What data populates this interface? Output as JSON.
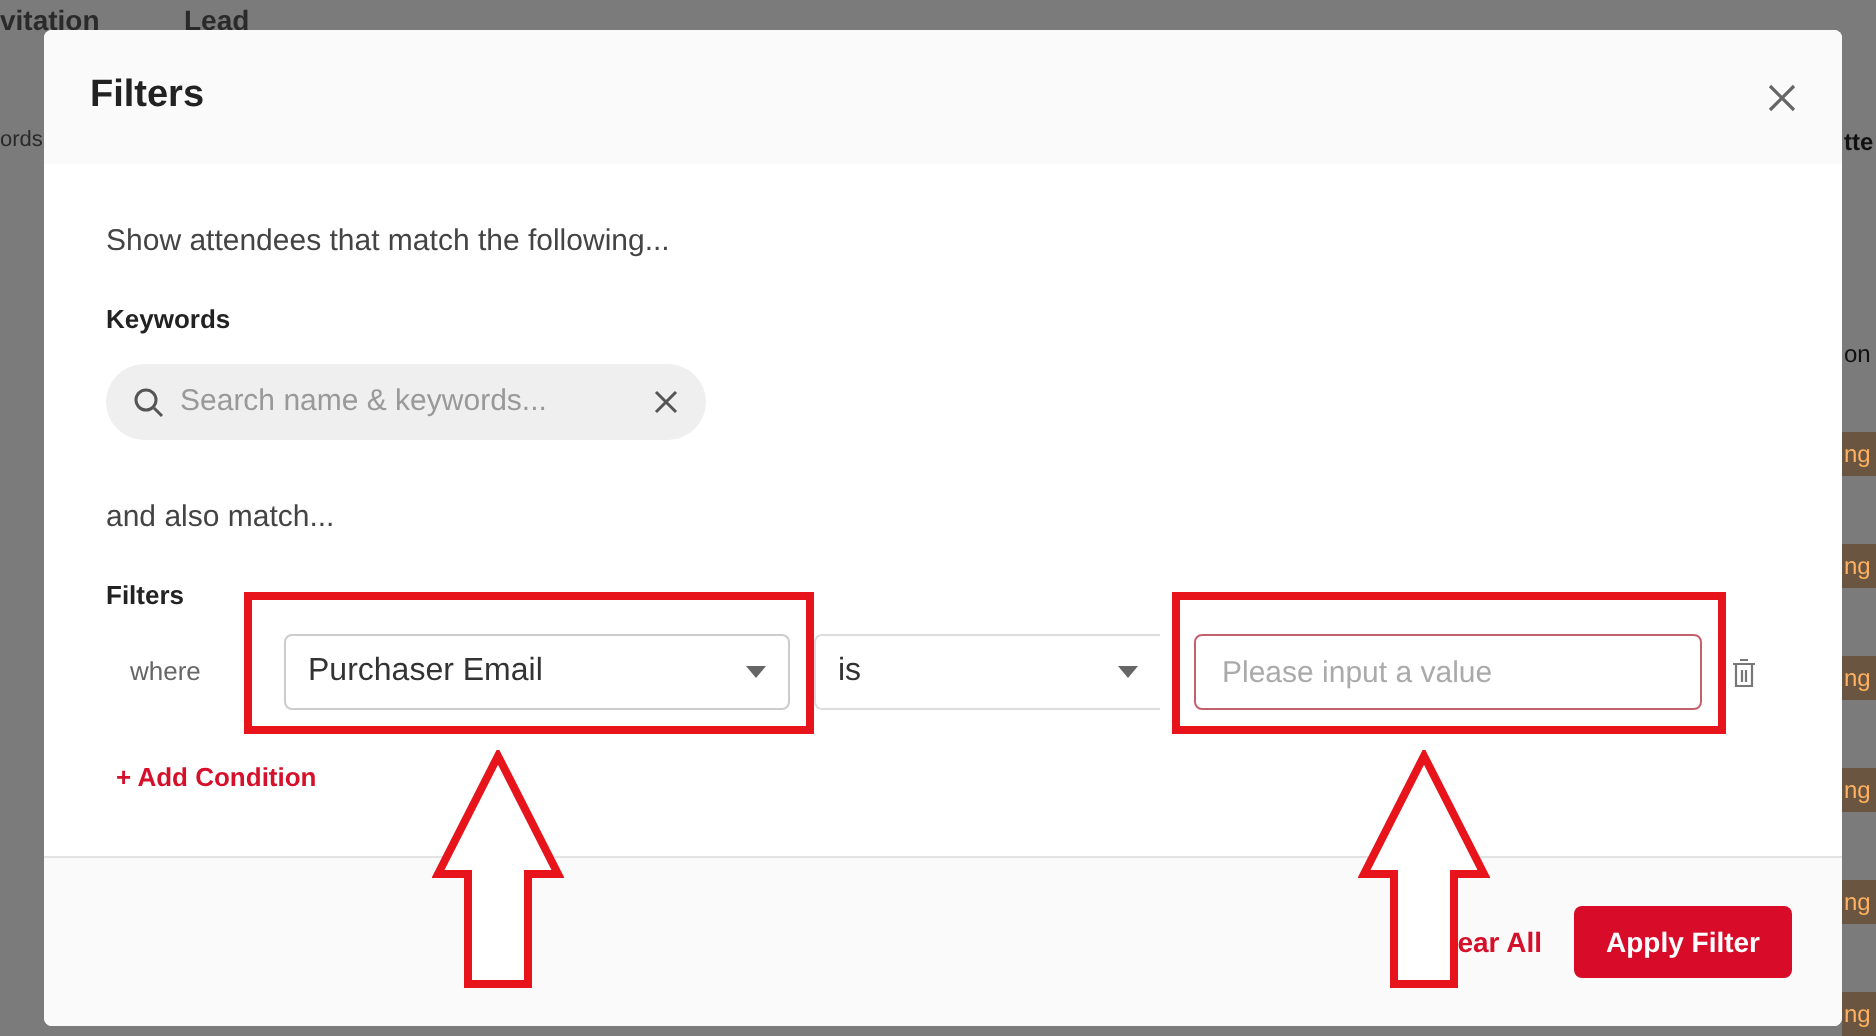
{
  "background": {
    "tabs": [
      "vitation",
      "Lead"
    ],
    "search_fragment": "ords",
    "column_fragments": [
      "tte",
      "on"
    ],
    "status_badges": [
      "ng",
      "ng",
      "ng",
      "ng",
      "ng",
      "ng"
    ]
  },
  "dialog": {
    "title": "Filters",
    "intro": "Show attendees that match the following...",
    "keywords_label": "Keywords",
    "search": {
      "placeholder": "Search name & keywords..."
    },
    "also_match": "and also match...",
    "filters_label": "Filters",
    "conditions": [
      {
        "prefix": "where",
        "field": "Purchaser Email",
        "operator": "is",
        "value_placeholder": "Please input a value"
      }
    ],
    "add_condition": "+ Add Condition",
    "clear_all": "ear All",
    "apply": "Apply Filter"
  }
}
